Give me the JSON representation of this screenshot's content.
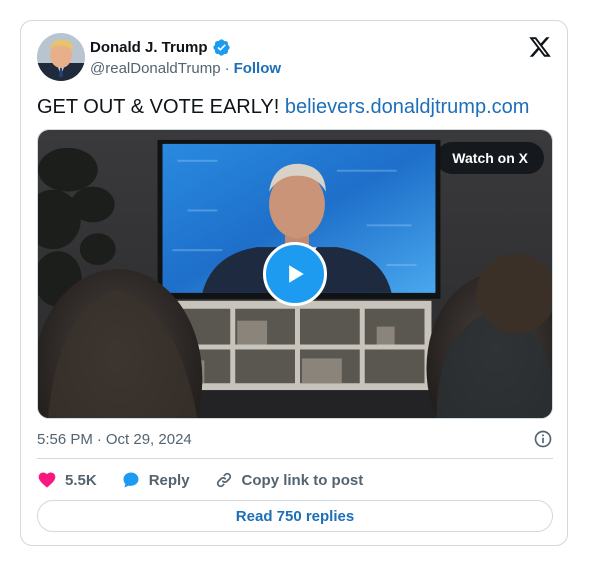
{
  "author": {
    "name": "Donald J. Trump",
    "handle": "@realDonaldTrump",
    "separator": "·",
    "follow_label": "Follow",
    "verified": true
  },
  "tweet": {
    "text": "GET OUT & VOTE EARLY!",
    "link_text": "believers.donaldjtrump.com"
  },
  "media": {
    "type": "video",
    "watch_label": "Watch on X"
  },
  "meta": {
    "time": "5:56 PM",
    "separator": "·",
    "date": "Oct 29, 2024"
  },
  "actions": {
    "likes": "5.5K",
    "reply_label": "Reply",
    "copy_label": "Copy link to post"
  },
  "read_replies_label": "Read 750 replies",
  "colors": {
    "link": "#1d6fb8",
    "verified": "#1d9bf0",
    "heart": "#f91880",
    "reply_bubble": "#1d9bf0",
    "border": "#cfd9de",
    "secondary_text": "#536471"
  },
  "icons": [
    "verified-badge-icon",
    "x-logo-icon",
    "play-icon",
    "info-icon",
    "heart-icon",
    "reply-icon",
    "link-icon"
  ]
}
